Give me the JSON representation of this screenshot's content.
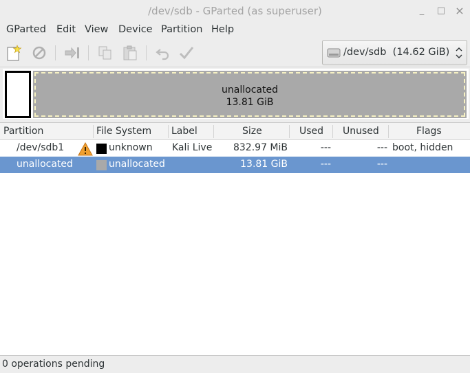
{
  "window": {
    "title": "/dev/sdb - GParted (as superuser)",
    "buttons": {
      "minimize": "_",
      "maximize": "□",
      "close": "×"
    }
  },
  "menubar": {
    "items": [
      {
        "label": "GParted"
      },
      {
        "label": "Edit"
      },
      {
        "label": "View"
      },
      {
        "label": "Device"
      },
      {
        "label": "Partition"
      },
      {
        "label": "Help"
      }
    ]
  },
  "toolbar": {
    "icons": [
      "new-partition-icon",
      "delete-icon",
      "resize-move-icon",
      "copy-icon",
      "paste-icon",
      "undo-icon",
      "apply-icon"
    ]
  },
  "device_selector": {
    "value": "/dev/sdb  (14.62 GiB)"
  },
  "disk_map": {
    "unallocated_label": "unallocated",
    "unallocated_size": "13.81 GiB"
  },
  "table": {
    "columns": [
      "Partition",
      "File System",
      "Label",
      "Size",
      "Used",
      "Unused",
      "Flags"
    ],
    "rows": [
      {
        "partition": "/dev/sdb1",
        "warning": true,
        "fs_color": "#000000",
        "filesystem": "unknown",
        "label": "Kali Live",
        "size": "832.97 MiB",
        "used": "---",
        "unused": "---",
        "flags": "boot, hidden",
        "selected": false
      },
      {
        "partition": "unallocated",
        "warning": false,
        "fs_color": "#a9a9a9",
        "filesystem": "unallocated",
        "label": "",
        "size": "13.81 GiB",
        "used": "---",
        "unused": "---",
        "flags": "",
        "selected": true
      }
    ]
  },
  "status": {
    "text": "0 operations pending"
  },
  "colors": {
    "selection": "#6a96cf",
    "unallocated": "#a9a9a9",
    "warning": "#f0a030"
  }
}
